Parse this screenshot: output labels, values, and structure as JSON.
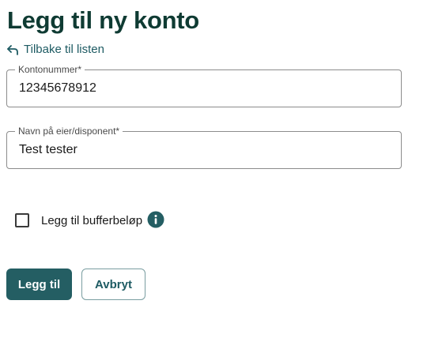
{
  "page": {
    "title": "Legg til ny konto",
    "back_link": "Tilbake til listen"
  },
  "form": {
    "account_number": {
      "label": "Kontonummer*",
      "value": "12345678912"
    },
    "owner_name": {
      "label": "Navn på eier/disponent*",
      "value": "Test tester"
    },
    "buffer": {
      "label": "Legg til bufferbeløp",
      "checked": false
    }
  },
  "actions": {
    "submit_label": "Legg til",
    "cancel_label": "Avbryt"
  },
  "icons": {
    "back": "arrow-back-icon",
    "info": "info-icon"
  },
  "colors": {
    "title": "#0f3b33",
    "accent": "#245e63",
    "link": "#1e5b63"
  }
}
